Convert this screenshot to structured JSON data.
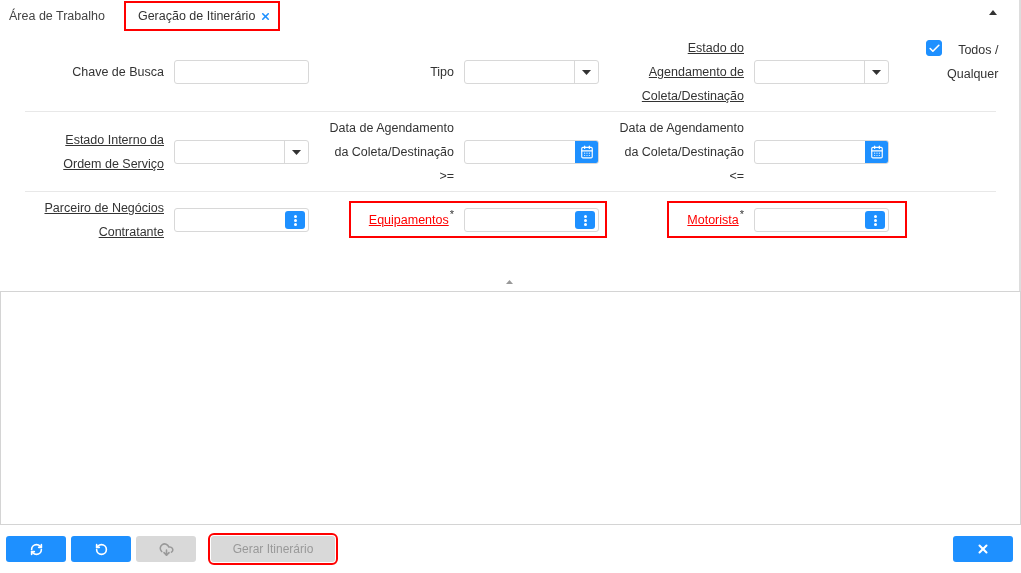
{
  "tabs": [
    {
      "label": "Área de Trabalho",
      "selected": false,
      "closable": false,
      "highlighted": false
    },
    {
      "label": "Geração de Itinerário",
      "selected": true,
      "closable": true,
      "highlighted": true
    }
  ],
  "filter_rows": [
    {
      "fields": [
        {
          "kind": "text",
          "label": "Chave de Busca",
          "link": false
        },
        {
          "kind": "select",
          "label": "Tipo",
          "link": false
        },
        {
          "kind": "select",
          "label": "Estado do\nAgendamento de\nColeta/Destinação",
          "link": true
        }
      ],
      "checkbox": {
        "label": "Todos /\nQualquer",
        "checked": true
      }
    },
    {
      "fields": [
        {
          "kind": "select",
          "label": "Estado Interno da\nOrdem de Serviço",
          "link": true
        },
        {
          "kind": "date",
          "label": "Data de Agendamento\nda Coleta/Destinação\n>=",
          "link": false
        },
        {
          "kind": "date",
          "label": "Data de Agendamento\nda Coleta/Destinação\n<=",
          "link": false
        }
      ]
    },
    {
      "fields": [
        {
          "kind": "lookup",
          "label": "Parceiro de Negócios\nContratante",
          "link": true
        },
        {
          "kind": "lookup",
          "label": "Equipamentos",
          "link": true,
          "required_mark": "*",
          "highlighted": true
        },
        {
          "kind": "lookup",
          "label": "Motorista",
          "link": true,
          "required_mark": "*",
          "highlighted": true
        }
      ]
    }
  ],
  "toolbar": [
    {
      "kind": "refresh",
      "disabled": false,
      "highlighted": false
    },
    {
      "kind": "undo",
      "disabled": false,
      "highlighted": false
    },
    {
      "kind": "cloud-download",
      "disabled": true,
      "highlighted": false
    },
    {
      "kind": "text",
      "label": "Gerar Itinerário",
      "disabled": true,
      "highlighted": true
    }
  ],
  "close_button": {
    "disabled": false
  }
}
